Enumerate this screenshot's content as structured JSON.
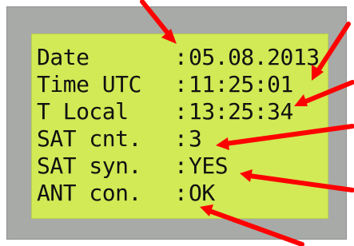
{
  "display": {
    "rows": [
      {
        "label": "Date",
        "colon": ":",
        "value": "05.08.2013"
      },
      {
        "label": "Time UTC",
        "colon": ":",
        "value": "11:25:01"
      },
      {
        "label": "T Local",
        "colon": ":",
        "value": "13:25:34"
      },
      {
        "label": "SAT cnt.",
        "colon": ":",
        "value": "3"
      },
      {
        "label": "SAT syn.",
        "colon": ":",
        "value": "YES"
      },
      {
        "label": "ANT con.",
        "colon": ":",
        "value": "OK"
      }
    ]
  },
  "colors": {
    "lcd_background": "#d1ea55",
    "bezel": "#a7aaa6",
    "text": "#111111",
    "arrow": "#ff0000"
  }
}
